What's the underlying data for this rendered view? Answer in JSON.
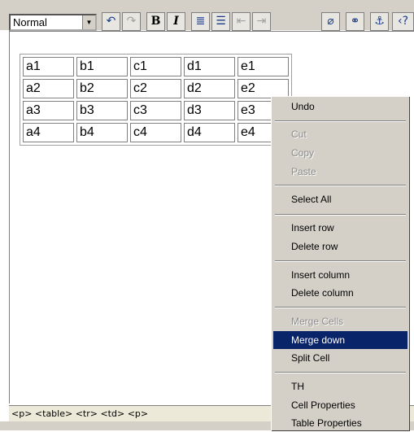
{
  "toolbar": {
    "format_select": {
      "value": "Normal"
    },
    "buttons": [
      {
        "name": "undo-icon",
        "glyph": "↶",
        "disabled": false
      },
      {
        "name": "redo-icon",
        "glyph": "↷",
        "disabled": true
      },
      {
        "name": "bold-icon",
        "glyph": "B",
        "disabled": false
      },
      {
        "name": "italic-icon",
        "glyph": "I",
        "disabled": false
      },
      {
        "name": "ordered-list-icon",
        "glyph": "≣",
        "disabled": false
      },
      {
        "name": "unordered-list-icon",
        "glyph": "☰",
        "disabled": false
      },
      {
        "name": "outdent-icon",
        "glyph": "⇤",
        "disabled": true
      },
      {
        "name": "indent-icon",
        "glyph": "⇥",
        "disabled": true
      },
      {
        "name": "paperclip-icon",
        "glyph": "⌀",
        "disabled": false
      },
      {
        "name": "link-icon",
        "glyph": "⚭",
        "disabled": false
      },
      {
        "name": "anchor-icon",
        "glyph": "⚓",
        "disabled": false
      },
      {
        "name": "source-icon",
        "glyph": "‹?",
        "disabled": false
      }
    ]
  },
  "table": {
    "rows": [
      [
        "a1",
        "b1",
        "c1",
        "d1",
        "e1"
      ],
      [
        "a2",
        "b2",
        "c2",
        "d2",
        "e2"
      ],
      [
        "a3",
        "b3",
        "c3",
        "d3",
        "e3"
      ],
      [
        "a4",
        "b4",
        "c4",
        "d4",
        "e4"
      ]
    ]
  },
  "status_bar": {
    "path": "<p> <table> <tr> <td> <p>"
  },
  "context_menu": {
    "items": [
      {
        "label": "Undo",
        "disabled": false
      },
      {
        "separator": true
      },
      {
        "label": "Cut",
        "disabled": true
      },
      {
        "label": "Copy",
        "disabled": true
      },
      {
        "label": "Paste",
        "disabled": true
      },
      {
        "separator": true
      },
      {
        "label": "Select All",
        "disabled": false
      },
      {
        "separator": true
      },
      {
        "label": "Insert row",
        "disabled": false
      },
      {
        "label": "Delete row",
        "disabled": false
      },
      {
        "separator": true
      },
      {
        "label": "Insert column",
        "disabled": false
      },
      {
        "label": "Delete column",
        "disabled": false
      },
      {
        "separator": true
      },
      {
        "label": "Merge Cells",
        "disabled": true
      },
      {
        "label": "Merge down",
        "disabled": false,
        "active": true
      },
      {
        "label": "Split Cell",
        "disabled": false
      },
      {
        "separator": true
      },
      {
        "label": "TH",
        "disabled": false
      },
      {
        "label": "Cell Properties",
        "disabled": false
      },
      {
        "label": "Table Properties",
        "disabled": false
      }
    ]
  }
}
